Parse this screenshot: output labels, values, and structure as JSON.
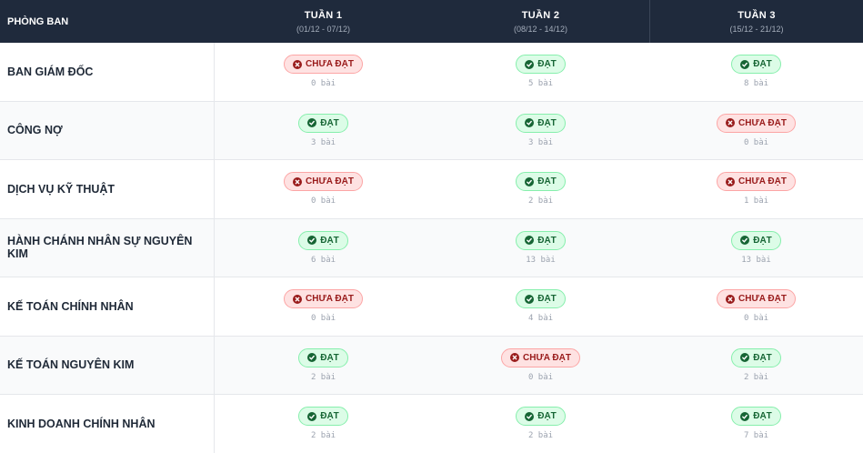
{
  "header": {
    "dept_label": "PHÒNG BAN",
    "weeks": [
      {
        "label": "TUẦN 1",
        "range": "(01/12 - 07/12)"
      },
      {
        "label": "TUẦN 2",
        "range": "(08/12 - 14/12)"
      },
      {
        "label": "TUẦN 3",
        "range": "(15/12 - 21/12)"
      }
    ]
  },
  "status_labels": {
    "pass": "ĐẠT",
    "fail": "CHƯA ĐẠT"
  },
  "colors": {
    "header_bg": "#1f2a3c",
    "pass_bg": "#dcfce7",
    "pass_text": "#166534",
    "fail_bg": "#fee2e2",
    "fail_text": "#991b1b"
  },
  "rows": [
    {
      "dept": "BAN GIÁM ĐỐC",
      "weeks": [
        {
          "status": "fail",
          "count": "0 bài"
        },
        {
          "status": "pass",
          "count": "5 bài"
        },
        {
          "status": "pass",
          "count": "8 bài"
        }
      ]
    },
    {
      "dept": "CÔNG NỢ",
      "weeks": [
        {
          "status": "pass",
          "count": "3 bài"
        },
        {
          "status": "pass",
          "count": "3 bài"
        },
        {
          "status": "fail",
          "count": "0 bài"
        }
      ]
    },
    {
      "dept": "DỊCH VỤ KỸ THUẬT",
      "weeks": [
        {
          "status": "fail",
          "count": "0 bài"
        },
        {
          "status": "pass",
          "count": "2 bài"
        },
        {
          "status": "fail",
          "count": "1 bài"
        }
      ]
    },
    {
      "dept": "HÀNH CHÁNH NHÂN SỰ NGUYÊN KIM",
      "weeks": [
        {
          "status": "pass",
          "count": "6 bài"
        },
        {
          "status": "pass",
          "count": "13 bài"
        },
        {
          "status": "pass",
          "count": "13 bài"
        }
      ]
    },
    {
      "dept": "KẾ TOÁN CHÍNH NHÂN",
      "weeks": [
        {
          "status": "fail",
          "count": "0 bài"
        },
        {
          "status": "pass",
          "count": "4 bài"
        },
        {
          "status": "fail",
          "count": "0 bài"
        }
      ]
    },
    {
      "dept": "KẾ TOÁN NGUYÊN KIM",
      "weeks": [
        {
          "status": "pass",
          "count": "2 bài"
        },
        {
          "status": "fail",
          "count": "0 bài"
        },
        {
          "status": "pass",
          "count": "2 bài"
        }
      ]
    },
    {
      "dept": "KINH DOANH CHÍNH NHÂN",
      "weeks": [
        {
          "status": "pass",
          "count": "2 bài"
        },
        {
          "status": "pass",
          "count": "2 bài"
        },
        {
          "status": "pass",
          "count": "7 bài"
        }
      ]
    }
  ]
}
